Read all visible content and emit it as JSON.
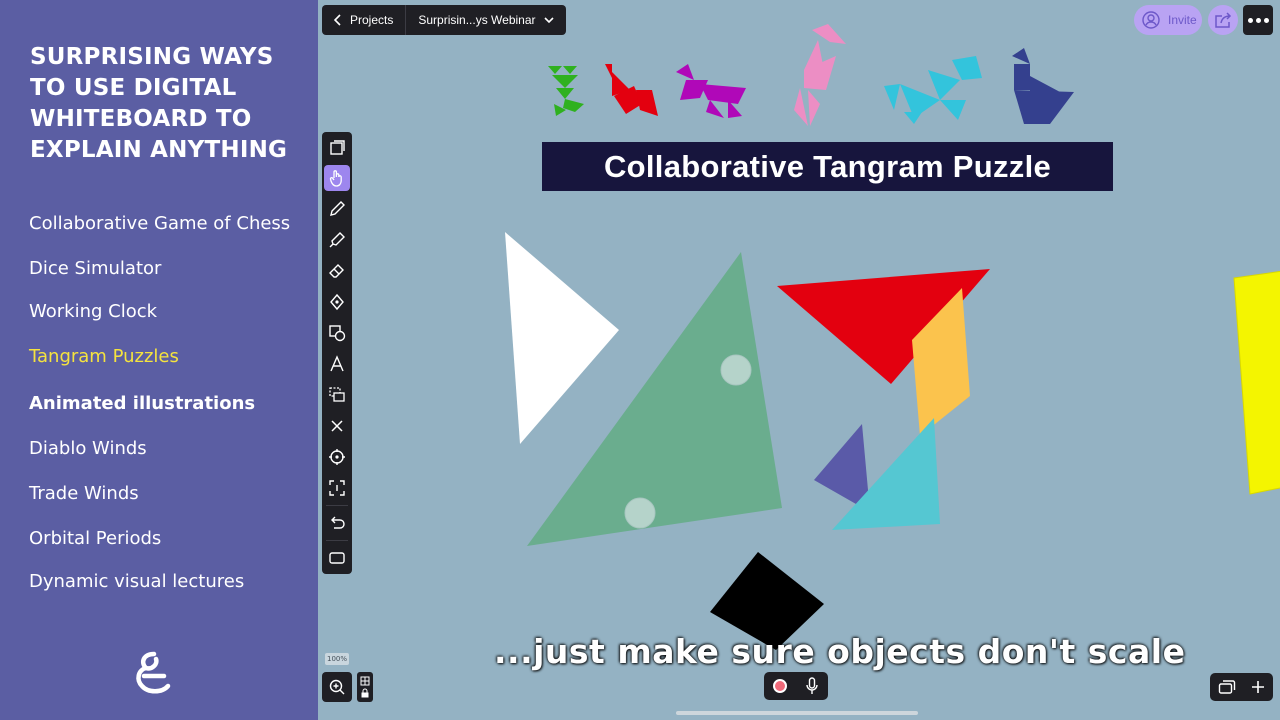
{
  "sidebar": {
    "title": "SURPRISING WAYS TO USE DIGITAL WHITEBOARD TO EXPLAIN ANYTHING",
    "items": [
      {
        "label": "Collaborative Game of Chess",
        "state": "normal"
      },
      {
        "label": "Dice Simulator",
        "state": "normal"
      },
      {
        "label": "Working Clock",
        "state": "normal"
      },
      {
        "label": "Tangram Puzzles",
        "state": "active"
      },
      {
        "label": "Animated illustrations",
        "state": "bold"
      },
      {
        "label": "Diablo Winds",
        "state": "normal"
      },
      {
        "label": "Trade Winds",
        "state": "normal"
      },
      {
        "label": "Orbital Periods",
        "state": "normal"
      },
      {
        "label": "Dynamic visual lectures",
        "state": "normal"
      }
    ],
    "logo_icon": "explain-everything-logo-icon"
  },
  "topbar": {
    "projects_label": "Projects",
    "project_name": "Surprisin...ys Webinar"
  },
  "header_right": {
    "invite_label": "Invite",
    "share_icon": "share-icon",
    "more_icon": "more-dots-icon"
  },
  "toolbar": {
    "tools": [
      "select-icon",
      "hand-icon",
      "pen-icon",
      "highlighter-icon",
      "eraser-icon",
      "fill-icon",
      "shapes-icon",
      "text-icon",
      "clone-icon",
      "delete-icon",
      "laser-pointer-icon",
      "focus-icon",
      "undo-icon",
      "slide-icon"
    ],
    "selected_tool": "hand-icon"
  },
  "slide": {
    "banner_title": "Collaborative Tangram Puzzle",
    "caption": "...just make sure objects don't scale"
  },
  "bottom": {
    "zoom_label": "100%",
    "zoom_icon": "zoom-icon",
    "record_icon": "record-icon",
    "mic_icon": "microphone-icon",
    "slides_icon": "slides-icon",
    "add_icon": "add-slide-icon"
  },
  "colors": {
    "sidebar_bg": "#5b5ea3",
    "active_item": "#f5e33e",
    "canvas_bg": "#94b2c3",
    "banner_bg": "#17153d",
    "toolbar_bg": "#1f1f24",
    "accent": "#9d86ee",
    "tangram_green": "#6aad8e",
    "tangram_red": "#e3000f",
    "tangram_orange": "#fbc34d",
    "tangram_blue": "#5a5aa8",
    "tangram_cyan": "#55c7d2",
    "tangram_yellow": "#f4f500",
    "tangram_magenta": "#b008b8",
    "tangram_pink": "#ec8ec4",
    "tangram_light_cyan": "#33c4dc",
    "tangram_navy": "#34408e"
  }
}
